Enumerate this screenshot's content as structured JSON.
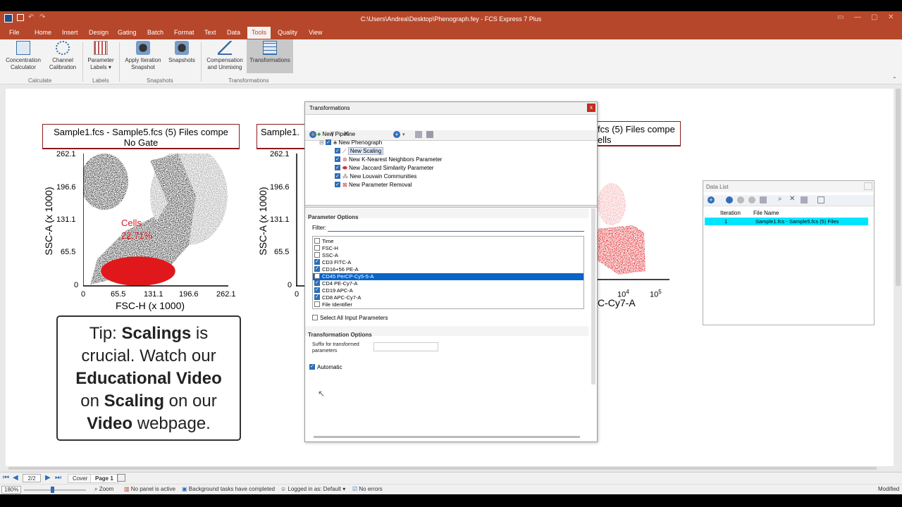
{
  "window": {
    "title": "C:\\Users\\Andrea\\Desktop\\Phenograph.fey - FCS Express 7 Plus"
  },
  "menu": {
    "items": [
      "File",
      "Home",
      "Insert",
      "Design",
      "Gating",
      "Batch",
      "Format",
      "Text",
      "Data",
      "Tools",
      "Quality",
      "View"
    ],
    "active": "Tools"
  },
  "ribbon": {
    "concentration": "Concentration\nCalculator",
    "channel": "Channel\nCalibration",
    "param_labels": "Parameter\nLabels ▾",
    "apply_iter": "Apply Iteration\nSnapshot",
    "snapshots": "Snapshots",
    "comp": "Compensation\nand Unmixing",
    "transformations": "Transformations",
    "grp_calculate": "Calculate",
    "grp_labels": "Labels",
    "grp_snapshots": "Snapshots",
    "grp_transformations": "Transformations"
  },
  "plot1": {
    "title_line1": "Sample1.fcs - Sample5.fcs (5) Files compe",
    "title_line2": "No Gate",
    "ylabel": "SSC-A (x 1000)",
    "xlabel": "FSC-H (x 1000)",
    "yticks": [
      "262.1",
      "196.6",
      "131.1",
      "65.5",
      "0"
    ],
    "xticks": [
      "0",
      "65.5",
      "131.1",
      "196.6",
      "262.1"
    ],
    "gate_name": "Cells",
    "gate_pct": "22.71%"
  },
  "plot2": {
    "title_line1": "Sample1.",
    "ylabel": "SSC-A (x 1000)",
    "yticks": [
      "262.1",
      "196.6",
      "131.1",
      "65.5",
      "0"
    ],
    "xtick0": "0"
  },
  "plot3": {
    "title_line1": "fcs (5) Files compe",
    "title_line2": "ells",
    "xlabel": "C-Cy7-A",
    "xtick_a": "10",
    "xtick_a_exp": "4",
    "xtick_b": "10",
    "xtick_b_exp": "5"
  },
  "tip": {
    "l1a": "Tip: ",
    "l1b": "Scalings",
    "l1c": " is",
    "l2": "crucial. Watch our",
    "l3": "Educational Video",
    "l4a": "on ",
    "l4b": "Scaling",
    "l4c": " on our",
    "l5a": "Video",
    "l5b": " webpage."
  },
  "dialog": {
    "title": "Transformations",
    "close": "x",
    "tree": {
      "pipeline": "New Pipeline",
      "phenograph": "New Phenograph",
      "scaling": "New Scaling",
      "knn": "New K-Nearest Neighbors Parameter",
      "jaccard": "New Jaccard Similarity Parameter",
      "louvain": "New Louvain Communities",
      "removal": "New Parameter Removal"
    },
    "param_options": "Parameter Options",
    "filter_label": "Filter:",
    "filter_value": "",
    "params": [
      {
        "name": "Time",
        "checked": false
      },
      {
        "name": "FSC-H",
        "checked": false
      },
      {
        "name": "SSC-A",
        "checked": false
      },
      {
        "name": "CD3 FITC-A",
        "checked": true
      },
      {
        "name": "CD16+56 PE-A",
        "checked": true
      },
      {
        "name": "CD45 PerCP-Cy5-5-A",
        "checked": false,
        "selected": true
      },
      {
        "name": "CD4 PE-Cy7-A",
        "checked": true
      },
      {
        "name": "CD19 APC-A",
        "checked": true
      },
      {
        "name": "CD8 APC-Cy7-A",
        "checked": true
      },
      {
        "name": "File Identifier",
        "checked": false
      }
    ],
    "select_all": "Select All Input Parameters",
    "transform_options": "Transformation Options",
    "suffix_label_1": "Suffix for transformed",
    "suffix_label_2": "parameters",
    "suffix_value": "",
    "automatic": "Automatic"
  },
  "datalist": {
    "title": "Data List",
    "col_iteration": "Iteration",
    "col_filename": "File Name",
    "row_iteration": "1",
    "row_filename": "Sample1.fcs - Sample5.fcs (5) Files"
  },
  "pager": {
    "page_indicator": "2/2",
    "tab_cover": "Cover",
    "tab_page1": "Page 1"
  },
  "status": {
    "zoom_value": "180%",
    "zoom_label": "Zoom",
    "panel": "No panel is active",
    "background": "Background tasks have completed",
    "logged": "Logged in as: Default",
    "errors": "No errors",
    "modified": "Modified"
  },
  "colors": {
    "brand": "#b7472a",
    "gate_red": "#e0181b",
    "selection": "#0a64c8",
    "datalist_row": "#00e5ff"
  }
}
